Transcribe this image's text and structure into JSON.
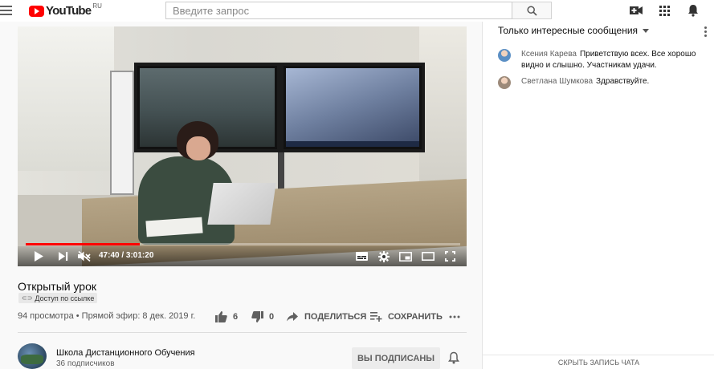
{
  "header": {
    "logo_text": "YouTube",
    "logo_region": "RU",
    "search_placeholder": "Введите запрос",
    "icons": [
      "menu-icon",
      "search-icon",
      "create-video-icon",
      "apps-grid-icon",
      "notifications-bell-icon"
    ]
  },
  "player": {
    "current_time": "47:40",
    "duration": "3:01:20",
    "time_display": "47:40 / 3:01:20",
    "progress_fraction": 0.263,
    "muted": true,
    "progress_color": "#ff0000",
    "controls": [
      "play-icon",
      "next-icon",
      "volume-muted-icon",
      "subtitles-icon",
      "settings-gear-icon",
      "miniplayer-icon",
      "theater-mode-icon",
      "fullscreen-icon"
    ]
  },
  "video": {
    "title": "Открытый урок",
    "access_badge": "Доступ по ссылке",
    "stats": "94 просмотра • Прямой эфир: 8 дек. 2019 г.",
    "likes": "6",
    "dislikes": "0",
    "share_label": "ПОДЕЛИТЬСЯ",
    "save_label": "СОХРАНИТЬ"
  },
  "channel": {
    "name": "Школа Дистанционного Обучения",
    "subscribers": "36 подписчиков",
    "subscribed_label": "ВЫ ПОДПИСАНЫ"
  },
  "chat": {
    "filter_label": "Только интересные сообщения",
    "messages": [
      {
        "author": "Ксения Карева",
        "text": "Приветствую всех. Все хорошо видно и слышно. Участникам удачи.",
        "avatar_color": "#5b8fc4"
      },
      {
        "author": "Светлана Шумкова",
        "text": "Здравствуйте.",
        "avatar_color": "#9c8a7a"
      }
    ],
    "hide_chat_label": "СКРЫТЬ ЗАПИСЬ ЧАТА"
  }
}
